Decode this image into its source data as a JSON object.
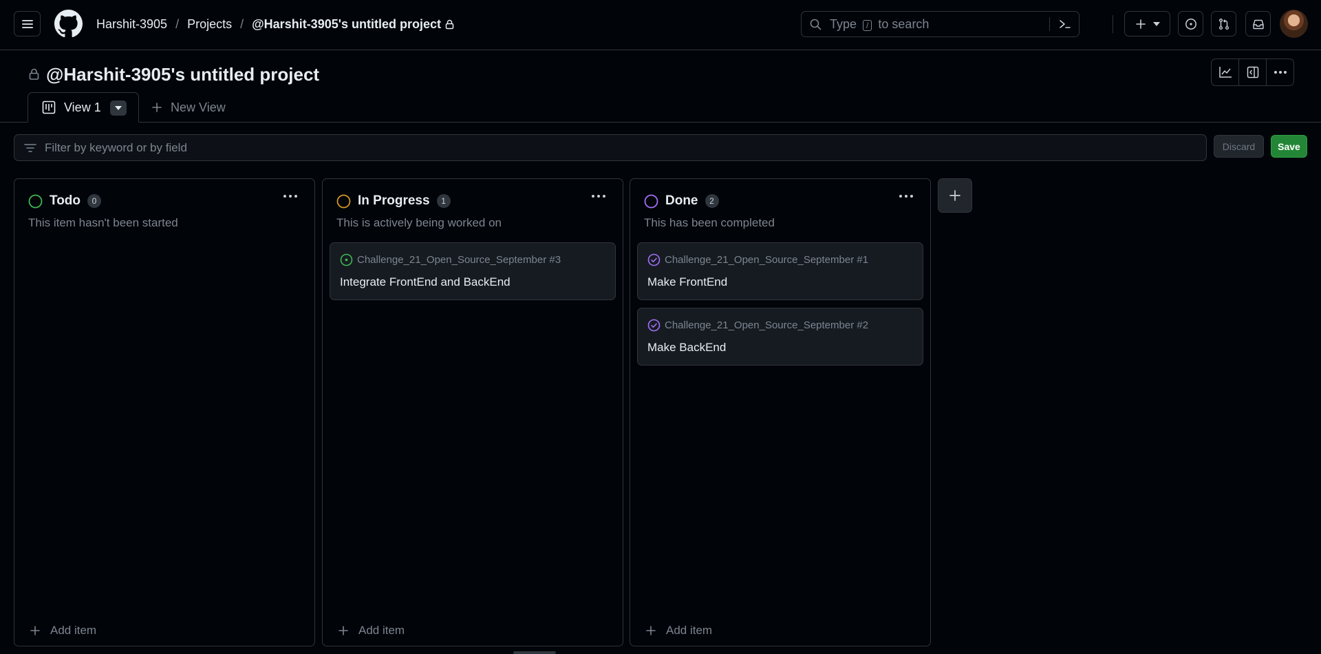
{
  "header": {
    "breadcrumb": {
      "owner": "Harshit-3905",
      "section": "Projects",
      "project": "@Harshit-3905's untitled project"
    },
    "search": {
      "type_word": "Type",
      "key": "/",
      "to_search": "to search"
    }
  },
  "project": {
    "title": "@Harshit-3905's untitled project",
    "tabs": {
      "active": "View 1",
      "new": "New View"
    },
    "filter": {
      "placeholder": "Filter by keyword or by field"
    },
    "discard_label": "Discard",
    "save_label": "Save"
  },
  "columns": [
    {
      "name": "Todo",
      "count": "0",
      "description": "This item hasn't been started",
      "color": "#3fb950",
      "add_label": "Add item",
      "cards": []
    },
    {
      "name": "In Progress",
      "count": "1",
      "description": "This is actively being worked on",
      "color": "#d29922",
      "add_label": "Add item",
      "cards": [
        {
          "ref": "Challenge_21_Open_Source_September #3",
          "title": "Integrate FrontEnd and BackEnd",
          "status": "open",
          "icon_color": "#3fb950"
        }
      ]
    },
    {
      "name": "Done",
      "count": "2",
      "description": "This has been completed",
      "color": "#a371f7",
      "add_label": "Add item",
      "cards": [
        {
          "ref": "Challenge_21_Open_Source_September #1",
          "title": "Make FrontEnd",
          "status": "closed",
          "icon_color": "#a371f7"
        },
        {
          "ref": "Challenge_21_Open_Source_September #2",
          "title": "Make BackEnd",
          "status": "closed",
          "icon_color": "#a371f7"
        }
      ]
    }
  ],
  "icons": {
    "menu": "hamburger-icon",
    "logo": "github-mark-icon",
    "lock": "lock-icon",
    "search": "search-icon",
    "command": "command-palette-icon",
    "create": "plus-icon",
    "issues": "issue-opened-icon",
    "pulls": "pull-request-icon",
    "inbox": "inbox-icon",
    "insights": "graph-icon",
    "side_panel": "sidebar-expand-icon",
    "more": "kebab-horizontal-icon",
    "board": "project-board-icon",
    "filter": "filter-icon"
  },
  "colors": {
    "background": "#010409",
    "border": "#30363d",
    "save": "#238636"
  }
}
